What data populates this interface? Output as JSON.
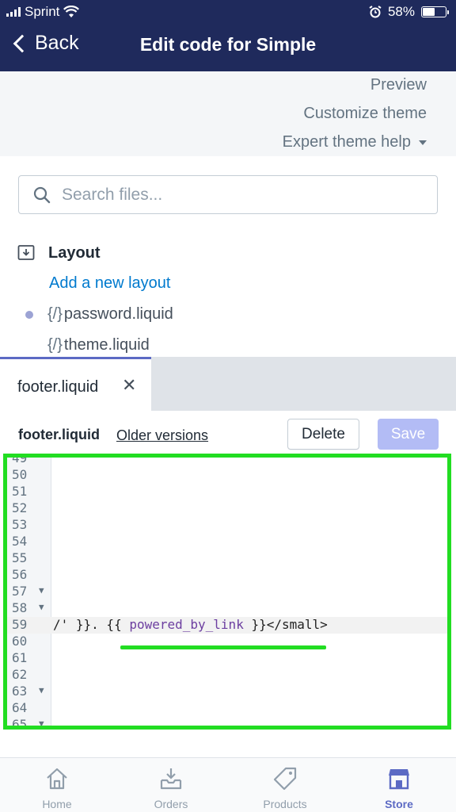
{
  "status": {
    "carrier": "Sprint",
    "battery": "58%"
  },
  "nav": {
    "back_label": "Back",
    "title": "Edit code for Simple"
  },
  "top_links": {
    "preview": "Preview",
    "customize": "Customize theme",
    "expert_help": "Expert theme help"
  },
  "search": {
    "placeholder": "Search files..."
  },
  "tree": {
    "section_label": "Layout",
    "add_label": "Add a new layout",
    "code_glyph": "{/}",
    "files": [
      {
        "name": "password.liquid",
        "dot": true
      },
      {
        "name": "theme.liquid",
        "dot": false
      }
    ]
  },
  "tab": {
    "label": "footer.liquid",
    "close": "✕"
  },
  "file_bar": {
    "file_name": "footer.liquid",
    "older_versions": "Older versions",
    "delete": "Delete",
    "save": "Save"
  },
  "editor": {
    "lines": [
      {
        "num": "49",
        "fold": false,
        "text": ""
      },
      {
        "num": "50",
        "fold": false,
        "text": ""
      },
      {
        "num": "51",
        "fold": false,
        "text": ""
      },
      {
        "num": "52",
        "fold": false,
        "text": ""
      },
      {
        "num": "53",
        "fold": false,
        "text": ""
      },
      {
        "num": "54",
        "fold": false,
        "text": ""
      },
      {
        "num": "55",
        "fold": false,
        "text": ""
      },
      {
        "num": "56",
        "fold": false,
        "text": ""
      },
      {
        "num": "57",
        "fold": true,
        "text": ""
      },
      {
        "num": "58",
        "fold": true,
        "text": ""
      },
      {
        "num": "59",
        "fold": false,
        "text_pre": "/' }}. {{ ",
        "text_var": "powered_by_link",
        "text_post": " }}</small>"
      },
      {
        "num": "60",
        "fold": false,
        "text": ""
      },
      {
        "num": "61",
        "fold": false,
        "text": ""
      },
      {
        "num": "62",
        "fold": false,
        "text": ""
      },
      {
        "num": "63",
        "fold": true,
        "text": ""
      },
      {
        "num": "64",
        "fold": false,
        "text": ""
      },
      {
        "num": "65",
        "fold": true,
        "text": ""
      }
    ]
  },
  "bottom_nav": {
    "items": [
      {
        "label": "Home",
        "icon": "home-icon"
      },
      {
        "label": "Orders",
        "icon": "orders-icon"
      },
      {
        "label": "Products",
        "icon": "tag-icon"
      },
      {
        "label": "Store",
        "icon": "store-icon"
      }
    ]
  },
  "colors": {
    "header_bg": "#1f2a5c",
    "accent": "#5c6ac4",
    "link": "#007ace",
    "highlight": "#22dd22"
  }
}
